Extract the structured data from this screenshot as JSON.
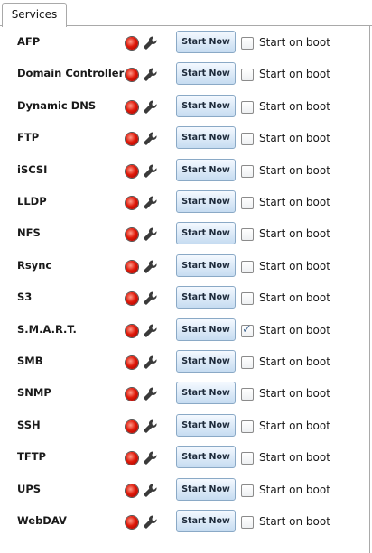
{
  "tabs": [
    {
      "label": "Services",
      "active": true
    }
  ],
  "start_label": "Start Now",
  "boot_label": "Start on boot",
  "services": [
    {
      "name": "AFP",
      "status": "stopped",
      "start_on_boot": false
    },
    {
      "name": "Domain Controller",
      "status": "stopped",
      "start_on_boot": false
    },
    {
      "name": "Dynamic DNS",
      "status": "stopped",
      "start_on_boot": false
    },
    {
      "name": "FTP",
      "status": "stopped",
      "start_on_boot": false
    },
    {
      "name": "iSCSI",
      "status": "stopped",
      "start_on_boot": false
    },
    {
      "name": "LLDP",
      "status": "stopped",
      "start_on_boot": false
    },
    {
      "name": "NFS",
      "status": "stopped",
      "start_on_boot": false
    },
    {
      "name": "Rsync",
      "status": "stopped",
      "start_on_boot": false
    },
    {
      "name": "S3",
      "status": "stopped",
      "start_on_boot": false
    },
    {
      "name": "S.M.A.R.T.",
      "status": "stopped",
      "start_on_boot": true
    },
    {
      "name": "SMB",
      "status": "stopped",
      "start_on_boot": false
    },
    {
      "name": "SNMP",
      "status": "stopped",
      "start_on_boot": false
    },
    {
      "name": "SSH",
      "status": "stopped",
      "start_on_boot": false
    },
    {
      "name": "TFTP",
      "status": "stopped",
      "start_on_boot": false
    },
    {
      "name": "UPS",
      "status": "stopped",
      "start_on_boot": false
    },
    {
      "name": "WebDAV",
      "status": "stopped",
      "start_on_boot": false
    }
  ],
  "colors": {
    "status_stopped": "#e01a0a",
    "button_border": "#8aa9c6",
    "check_color": "#4a6e96"
  },
  "icons": {
    "status": "status-dot-icon",
    "configure": "wrench-icon",
    "check": "checkmark-icon"
  }
}
